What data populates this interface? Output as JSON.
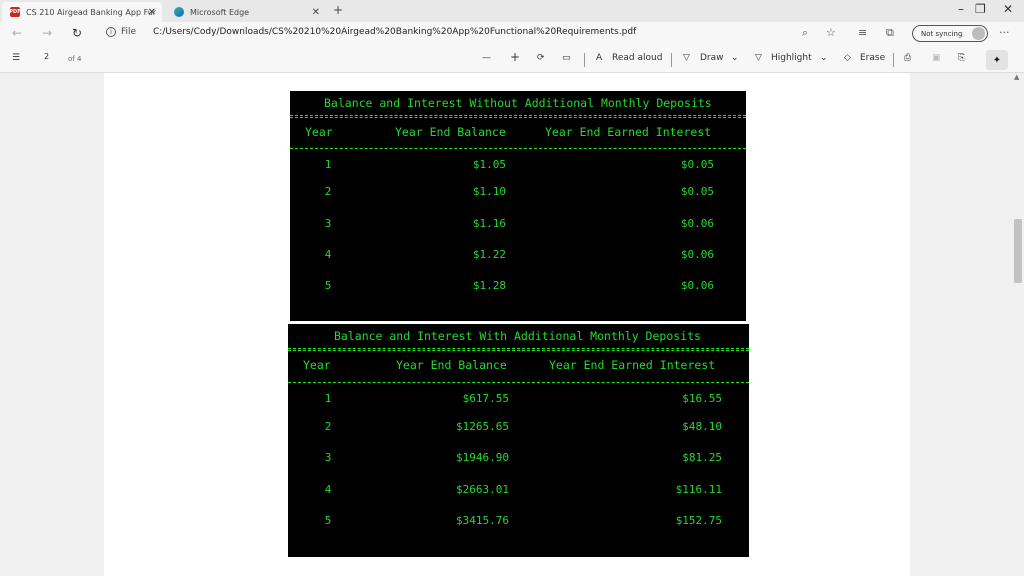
{
  "tabs": [
    {
      "title": "CS 210 Airgead Banking App Fur",
      "active": true
    },
    {
      "title": "Microsoft Edge",
      "active": false
    }
  ],
  "address": {
    "file_label": "File",
    "url": "C:/Users/Cody/Downloads/CS%20210%20Airgead%20Banking%20App%20Functional%20Requirements.pdf",
    "sync_label": "Not syncing"
  },
  "pdf_toolbar": {
    "page_current": "2",
    "page_total": "of 4",
    "read_aloud": "Read aloud",
    "draw": "Draw",
    "highlight": "Highlight",
    "erase": "Erase"
  },
  "reports": [
    {
      "title": "Balance and Interest Without Additional Monthly Deposits",
      "headers": [
        "Year",
        "Year End Balance",
        "Year End Earned Interest"
      ],
      "rows": [
        {
          "year": "1",
          "balance": "$1.05",
          "interest": "$0.05"
        },
        {
          "year": "2",
          "balance": "$1.10",
          "interest": "$0.05"
        },
        {
          "year": "3",
          "balance": "$1.16",
          "interest": "$0.06"
        },
        {
          "year": "4",
          "balance": "$1.22",
          "interest": "$0.06"
        },
        {
          "year": "5",
          "balance": "$1.28",
          "interest": "$0.06"
        }
      ]
    },
    {
      "title": "Balance and Interest With Additional Monthly Deposits",
      "headers": [
        "Year",
        "Year End Balance",
        "Year End Earned Interest"
      ],
      "rows": [
        {
          "year": "1",
          "balance": "$617.55",
          "interest": "$16.55"
        },
        {
          "year": "2",
          "balance": "$1265.65",
          "interest": "$48.10"
        },
        {
          "year": "3",
          "balance": "$1946.90",
          "interest": "$81.25"
        },
        {
          "year": "4",
          "balance": "$2663.01",
          "interest": "$116.11"
        },
        {
          "year": "5",
          "balance": "$3415.76",
          "interest": "$152.75"
        }
      ]
    }
  ],
  "colors": {
    "console_bg": "#000000",
    "console_text": "#25d82d",
    "pdf_badge": "#c9281c"
  }
}
